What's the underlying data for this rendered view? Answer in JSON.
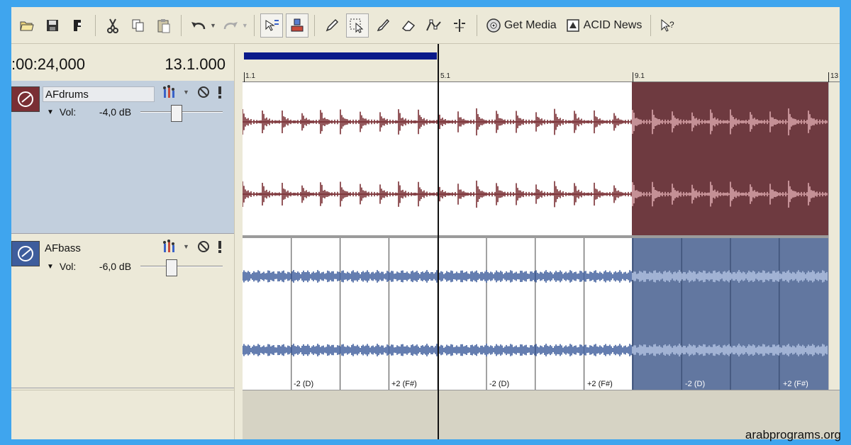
{
  "toolbar": {
    "get_media_label": "Get Media",
    "acid_news_label": "ACID News",
    "icons": [
      "open-icon",
      "save-icon",
      "properties-icon",
      "cut-icon",
      "copy-icon",
      "paste-icon",
      "undo-icon",
      "redo-icon",
      "auto-scroll-icon",
      "snap-icon",
      "draw-tool-icon",
      "select-tool-icon",
      "paint-tool-icon",
      "erase-tool-icon",
      "envelope-tool-icon",
      "split-tool-icon",
      "help-icon"
    ]
  },
  "transport": {
    "timecode": ":00:24,000",
    "bbt": "13.1.000"
  },
  "tracks": [
    {
      "name": "AFdrums",
      "vol_label": "Vol:",
      "vol_value": "-4,0 dB",
      "vol_level": 0.43,
      "color": "#7a2f34"
    },
    {
      "name": "AFbass",
      "vol_label": "Vol:",
      "vol_value": "-6,0 dB",
      "vol_level": 0.36,
      "color": "#3e5d9c"
    }
  ],
  "ruler": {
    "markers": [
      "1.1",
      "5.1",
      "9.1",
      "13"
    ]
  },
  "bass_pitch_labels": [
    "-2 (D)",
    "+2 (F#)",
    "-2 (D)",
    "+2 (F#)",
    "-2 (D)",
    "+2 (F#)"
  ],
  "watermark": "arabprograms.org",
  "colors": {
    "background": "#3fa5ee",
    "drums_wave": "#7a2f34",
    "bass_wave": "#3e5d9c",
    "loop_bar": "#0a1a8a"
  }
}
